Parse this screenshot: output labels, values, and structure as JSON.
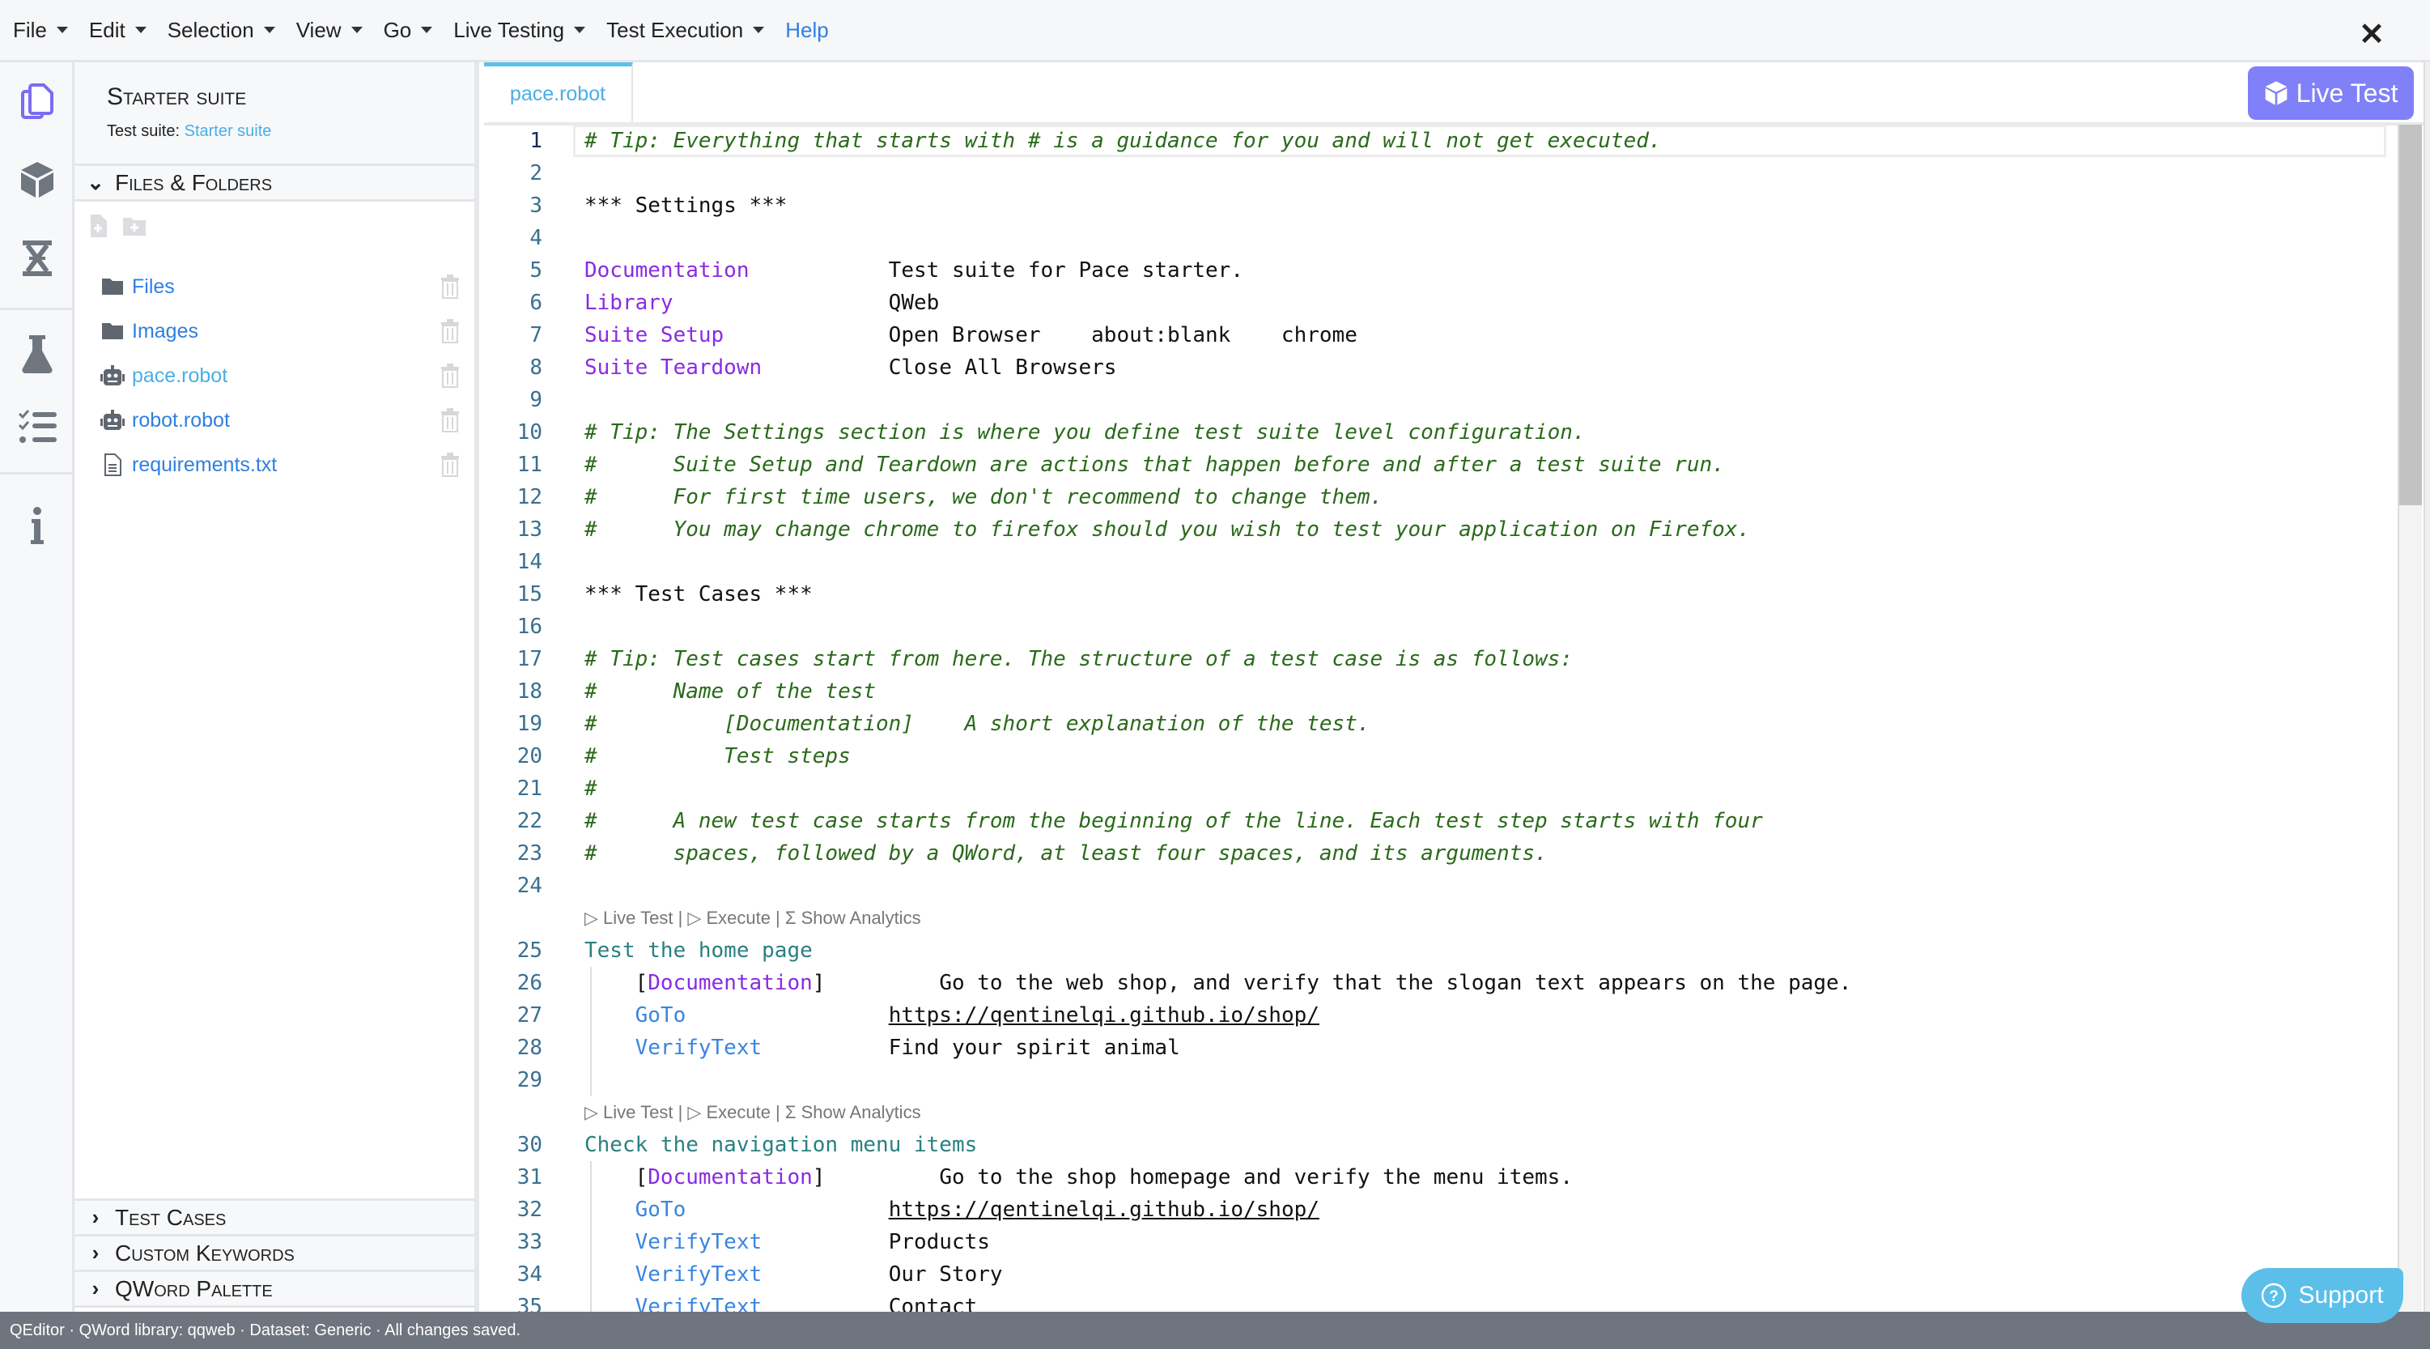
{
  "menubar": {
    "items": [
      "File",
      "Edit",
      "Selection",
      "View",
      "Go",
      "Live Testing",
      "Test Execution"
    ],
    "help": "Help"
  },
  "sidebar": {
    "suite_title": "Starter suite",
    "suite_label": "Test suite:",
    "suite_value": "Starter suite",
    "files_header": "Files & Folders",
    "files": [
      {
        "name": "Files",
        "icon": "folder-icon"
      },
      {
        "name": "Images",
        "icon": "folder-icon"
      },
      {
        "name": "pace.robot",
        "icon": "robot-icon",
        "active": true
      },
      {
        "name": "robot.robot",
        "icon": "robot-icon"
      },
      {
        "name": "requirements.txt",
        "icon": "file-text-icon"
      }
    ],
    "sections": [
      "Test Cases",
      "Custom Keywords",
      "QWord Palette"
    ]
  },
  "editor": {
    "tab": "pace.robot",
    "live_test_button": "Live Test",
    "accent": "#8080f8",
    "rows": [
      {
        "n": "1",
        "s": [
          [
            "cm",
            "# Tip: Everything that starts with # is a guidance for you and will not get executed."
          ]
        ]
      },
      {
        "n": "2",
        "s": []
      },
      {
        "n": "3",
        "s": [
          [
            "pl",
            "*** Settings ***"
          ]
        ]
      },
      {
        "n": "4",
        "s": []
      },
      {
        "n": "5",
        "s": [
          [
            "kw",
            "Documentation"
          ],
          [
            "pl",
            "           Test suite for Pace starter."
          ]
        ]
      },
      {
        "n": "6",
        "s": [
          [
            "kw",
            "Library"
          ],
          [
            "pl",
            "                 QWeb"
          ]
        ]
      },
      {
        "n": "7",
        "s": [
          [
            "kw",
            "Suite Setup"
          ],
          [
            "pl",
            "             Open Browser    about:blank    chrome"
          ]
        ]
      },
      {
        "n": "8",
        "s": [
          [
            "kw",
            "Suite Teardown"
          ],
          [
            "pl",
            "          Close All Browsers"
          ]
        ]
      },
      {
        "n": "9",
        "s": []
      },
      {
        "n": "10",
        "s": [
          [
            "cm",
            "# Tip: The Settings section is where you define test suite level configuration."
          ]
        ]
      },
      {
        "n": "11",
        "s": [
          [
            "cm",
            "#      Suite Setup and Teardown are actions that happen before and after a test suite run."
          ]
        ]
      },
      {
        "n": "12",
        "s": [
          [
            "cm",
            "#      For first time users, we don't recommend to change them."
          ]
        ]
      },
      {
        "n": "13",
        "s": [
          [
            "cm",
            "#      You may change chrome to firefox should you wish to test your application on Firefox."
          ]
        ]
      },
      {
        "n": "14",
        "s": []
      },
      {
        "n": "15",
        "s": [
          [
            "pl",
            "*** Test Cases ***"
          ]
        ]
      },
      {
        "n": "16",
        "s": []
      },
      {
        "n": "17",
        "s": [
          [
            "cm",
            "# Tip: Test cases start from here. The structure of a test case is as follows:"
          ]
        ]
      },
      {
        "n": "18",
        "s": [
          [
            "cm",
            "#      Name of the test"
          ]
        ]
      },
      {
        "n": "19",
        "s": [
          [
            "cm",
            "#          [Documentation]    A short explanation of the test."
          ]
        ]
      },
      {
        "n": "20",
        "s": [
          [
            "cm",
            "#          Test steps"
          ]
        ]
      },
      {
        "n": "21",
        "s": [
          [
            "cm",
            "#"
          ]
        ]
      },
      {
        "n": "22",
        "s": [
          [
            "cm",
            "#      A new test case starts from the beginning of the line. Each test step starts with four"
          ]
        ]
      },
      {
        "n": "23",
        "s": [
          [
            "cm",
            "#      spaces, followed by a QWord, at least four spaces, and its arguments."
          ]
        ]
      },
      {
        "n": "24",
        "s": []
      },
      {
        "lens": [
          "▷ Live Test",
          "▷ Execute",
          "Σ Show Analytics"
        ]
      },
      {
        "n": "25",
        "s": [
          [
            "tc",
            "Test the home page"
          ]
        ]
      },
      {
        "n": "26",
        "s": [
          [
            "pl",
            "    ["
          ],
          [
            "kw",
            "Documentation"
          ],
          [
            "pl",
            "]         Go to the web shop, and verify that the slogan text appears on the page."
          ]
        ]
      },
      {
        "n": "27",
        "s": [
          [
            "qw",
            "    GoTo"
          ],
          [
            "pl",
            "                "
          ],
          [
            "link",
            "https://qentinelqi.github.io/shop/"
          ]
        ]
      },
      {
        "n": "28",
        "s": [
          [
            "qw",
            "    VerifyText"
          ],
          [
            "pl",
            "          Find your spirit animal"
          ]
        ]
      },
      {
        "n": "29",
        "s": []
      },
      {
        "lens": [
          "▷ Live Test",
          "▷ Execute",
          "Σ Show Analytics"
        ]
      },
      {
        "n": "30",
        "s": [
          [
            "tc",
            "Check the navigation menu items"
          ]
        ]
      },
      {
        "n": "31",
        "s": [
          [
            "pl",
            "    ["
          ],
          [
            "kw",
            "Documentation"
          ],
          [
            "pl",
            "]         Go to the shop homepage and verify the menu items."
          ]
        ]
      },
      {
        "n": "32",
        "s": [
          [
            "qw",
            "    GoTo"
          ],
          [
            "pl",
            "                "
          ],
          [
            "link",
            "https://qentinelqi.github.io/shop/"
          ]
        ]
      },
      {
        "n": "33",
        "s": [
          [
            "qw",
            "    VerifyText"
          ],
          [
            "pl",
            "          Products"
          ]
        ]
      },
      {
        "n": "34",
        "s": [
          [
            "qw",
            "    VerifyText"
          ],
          [
            "pl",
            "          Our Story"
          ]
        ]
      },
      {
        "n": "35",
        "s": [
          [
            "qw",
            "    VerifyText"
          ],
          [
            "pl",
            "          Contact"
          ]
        ]
      }
    ]
  },
  "status_bar": "QEditor · QWord library: qqweb · Dataset: Generic · All changes saved.",
  "support_button": "Support",
  "colors": {
    "comment": "#2a6a1a",
    "keyword": "#8a2be2",
    "qword": "#3a85e0",
    "test_name": "#2a8080",
    "support": "#5bbfea",
    "status_bar": "#6f757e"
  }
}
